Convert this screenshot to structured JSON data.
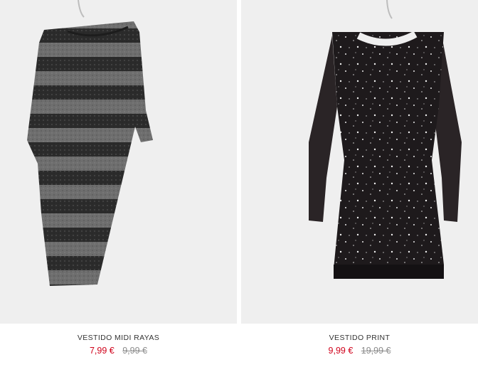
{
  "products": [
    {
      "name": "VESTIDO MIDI RAYAS",
      "sale_price": "7,99 €",
      "original_price": "9,99 €",
      "image": "striped-midi-dress-image"
    },
    {
      "name": "VESTIDO PRINT",
      "sale_price": "9,99 €",
      "original_price": "19,99 €",
      "image": "star-print-dress-image"
    }
  ],
  "colors": {
    "sale_price": "#d0021b",
    "original_price": "#8a8a8a",
    "photo_background": "#efefef"
  }
}
